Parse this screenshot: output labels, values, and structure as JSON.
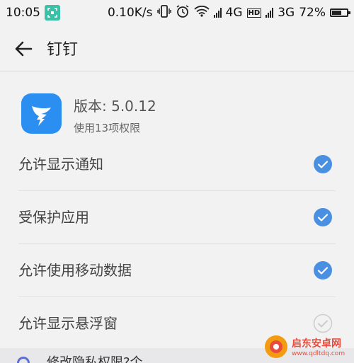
{
  "status_bar": {
    "time": "10:05",
    "speed": "0.10K/s",
    "network1": "4G",
    "hd": "HD",
    "network2": "3G",
    "battery": "72%",
    "battery_level": 0.72
  },
  "header": {
    "title": "钉钉"
  },
  "app": {
    "version": "版本: 5.0.12",
    "permissions": "使用13项权限",
    "icon_color": "#2a8ff0"
  },
  "settings": [
    {
      "label": "允许显示通知",
      "checked": true
    },
    {
      "label": "受保护应用",
      "checked": true
    },
    {
      "label": "允许使用移动数据",
      "checked": true
    },
    {
      "label": "允许显示悬浮窗",
      "checked": false
    }
  ],
  "bottom": {
    "text": "修改隐私权限?个"
  },
  "watermark": {
    "name": "启东安卓网",
    "url": "www.qdltdq.com"
  },
  "colors": {
    "accent": "#4a90e2",
    "unchecked": "#cccccc"
  }
}
